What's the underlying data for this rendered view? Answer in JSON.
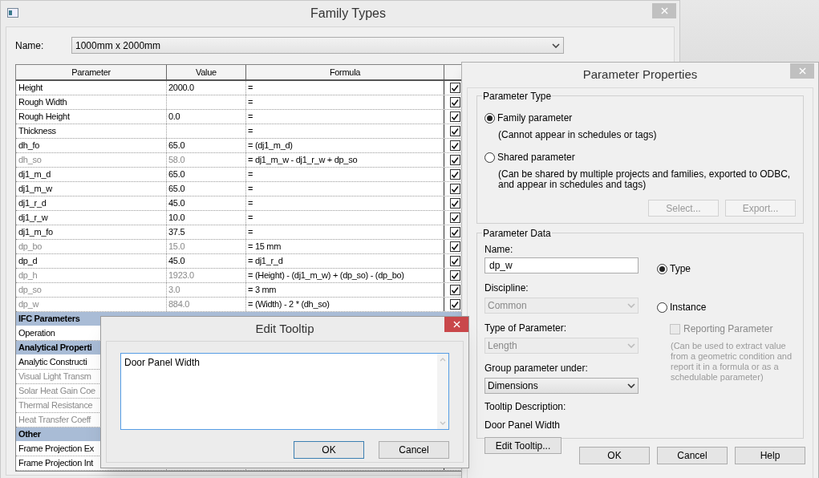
{
  "family_types": {
    "title": "Family Types",
    "name_label": "Name:",
    "name_value": "1000mm x 2000mm",
    "columns": [
      "Parameter",
      "Value",
      "Formula"
    ],
    "rows": [
      {
        "kind": "param",
        "parameter": "Height",
        "value": "2000.0",
        "formula": "=",
        "checked": true,
        "dimmed": false
      },
      {
        "kind": "param",
        "parameter": "Rough Width",
        "value": "",
        "formula": "=",
        "checked": true,
        "dimmed": false
      },
      {
        "kind": "param",
        "parameter": "Rough Height",
        "value": "0.0",
        "formula": "=",
        "checked": true,
        "dimmed": false
      },
      {
        "kind": "param",
        "parameter": "Thickness",
        "value": "",
        "formula": "=",
        "checked": true,
        "dimmed": false
      },
      {
        "kind": "param",
        "parameter": "dh_fo",
        "value": "65.0",
        "formula": "= (dj1_m_d)",
        "checked": true,
        "dimmed": false
      },
      {
        "kind": "param",
        "parameter": "dh_so",
        "value": "58.0",
        "formula": "= dj1_m_w - dj1_r_w + dp_so",
        "checked": true,
        "dimmed": true
      },
      {
        "kind": "param",
        "parameter": "dj1_m_d",
        "value": "65.0",
        "formula": "=",
        "checked": true,
        "dimmed": false
      },
      {
        "kind": "param",
        "parameter": "dj1_m_w",
        "value": "65.0",
        "formula": "=",
        "checked": true,
        "dimmed": false
      },
      {
        "kind": "param",
        "parameter": "dj1_r_d",
        "value": "45.0",
        "formula": "=",
        "checked": true,
        "dimmed": false
      },
      {
        "kind": "param",
        "parameter": "dj1_r_w",
        "value": "10.0",
        "formula": "=",
        "checked": true,
        "dimmed": false
      },
      {
        "kind": "param",
        "parameter": "dj1_m_fo",
        "value": "37.5",
        "formula": "=",
        "checked": true,
        "dimmed": false
      },
      {
        "kind": "param",
        "parameter": "dp_bo",
        "value": "15.0",
        "formula": "= 15 mm",
        "checked": true,
        "dimmed": true
      },
      {
        "kind": "param",
        "parameter": "dp_d",
        "value": "45.0",
        "formula": "= dj1_r_d",
        "checked": true,
        "dimmed": false
      },
      {
        "kind": "param",
        "parameter": "dp_h",
        "value": "1923.0",
        "formula": "= (Height) - (dj1_m_w) + (dp_so) - (dp_bo)",
        "checked": true,
        "dimmed": true
      },
      {
        "kind": "param",
        "parameter": "dp_so",
        "value": "3.0",
        "formula": "= 3 mm",
        "checked": true,
        "dimmed": true
      },
      {
        "kind": "param",
        "parameter": "dp_w",
        "value": "884.0",
        "formula": "= (Width) - 2 * (dh_so)",
        "checked": true,
        "dimmed": true
      },
      {
        "kind": "group",
        "parameter": "IFC Parameters"
      },
      {
        "kind": "param",
        "parameter": "Operation",
        "dimmed": false
      },
      {
        "kind": "group",
        "parameter": "Analytical Properti"
      },
      {
        "kind": "param",
        "parameter": "Analytic Constructi",
        "dimmed": false
      },
      {
        "kind": "param",
        "parameter": "Visual Light Transm",
        "dimmed": true
      },
      {
        "kind": "param",
        "parameter": "Solar Heat Gain Coe",
        "dimmed": true
      },
      {
        "kind": "param",
        "parameter": "Thermal Resistance",
        "dimmed": true
      },
      {
        "kind": "param",
        "parameter": "Heat Transfer Coeff",
        "dimmed": true
      },
      {
        "kind": "group",
        "parameter": "Other"
      },
      {
        "kind": "param",
        "parameter": "Frame Projection Ex",
        "dimmed": false
      },
      {
        "kind": "param",
        "parameter": "Frame Projection Int",
        "dimmed": false
      }
    ]
  },
  "parameter_properties": {
    "title": "Parameter Properties",
    "parameter_type": {
      "legend": "Parameter Type",
      "options": [
        {
          "label": "Family parameter",
          "description": "(Cannot appear in schedules or tags)",
          "selected": true
        },
        {
          "label": "Shared parameter",
          "description": "(Can be shared by multiple projects and families, exported to ODBC, and appear in schedules and tags)",
          "selected": false
        }
      ],
      "buttons": [
        {
          "label": "Select...",
          "disabled": true
        },
        {
          "label": "Export...",
          "disabled": true
        }
      ]
    },
    "parameter_data": {
      "legend": "Parameter Data",
      "name_label": "Name:",
      "name_value": "dp_w",
      "selects": [
        {
          "label": "Discipline:",
          "value": "Common",
          "disabled": true
        },
        {
          "label": "Type of Parameter:",
          "value": "Length",
          "disabled": true
        },
        {
          "label": "Group parameter under:",
          "value": "Dimensions",
          "disabled": false
        }
      ],
      "tooltip_label": "Tooltip Description:",
      "tooltip_value": "Door Panel Width",
      "edit_tooltip_button": "Edit Tooltip...",
      "scope": [
        {
          "label": "Type",
          "selected": true
        },
        {
          "label": "Instance",
          "selected": false
        }
      ],
      "reporting": {
        "label": "Reporting Parameter",
        "checked": false,
        "disabled": true
      },
      "reporting_note": "(Can be used to extract value from a geometric condition and report it in a formula or as a schedulable parameter)"
    },
    "buttons": [
      "OK",
      "Cancel",
      "Help"
    ]
  },
  "edit_tooltip": {
    "title": "Edit Tooltip",
    "text": "Door Panel Width",
    "buttons": [
      {
        "label": "OK",
        "default": true
      },
      {
        "label": "Cancel",
        "default": false
      }
    ]
  }
}
